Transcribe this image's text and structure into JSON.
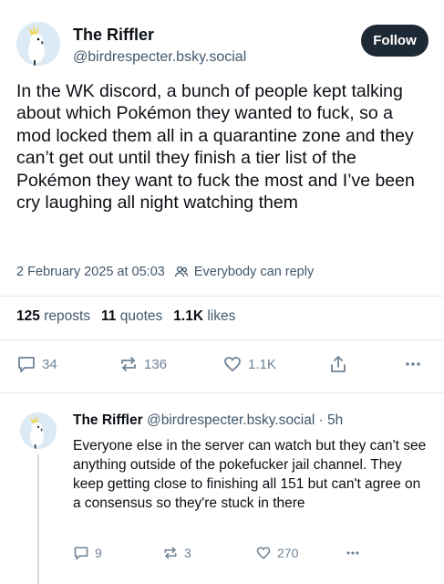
{
  "post": {
    "author_name": "The Riffler",
    "author_handle": "@birdrespecter.bsky.social",
    "follow_label": "Follow",
    "text": "In the WK discord, a bunch of people kept talking about which Pokémon they wanted to fuck, so a mod locked them all in a quarantine zone and they can’t get out until they finish a tier list of the Pokémon they want to fuck the most and I’ve been cry laughing all night watching them",
    "timestamp": "2 February 2025 at 05:03",
    "audience": "Everybody can reply",
    "stats": {
      "reposts_count": "125",
      "reposts_label": "reposts",
      "quotes_count": "11",
      "quotes_label": "quotes",
      "likes_count": "1.1K",
      "likes_label": "likes"
    },
    "actions": {
      "replies": "34",
      "reposts": "136",
      "likes": "1.1K"
    }
  },
  "reply": {
    "author_name": "The Riffler",
    "author_handle": "@birdrespecter.bsky.social",
    "age": "· 5h",
    "text": "Everyone else in the server can watch but they can't see anything outside of the pokefucker jail channel. They keep getting close to finishing all 151 but can't agree on a consensus so they're stuck in there",
    "actions": {
      "replies": "9",
      "reposts": "3",
      "likes": "270"
    }
  },
  "icons": {
    "reply": "speech-bubble-icon",
    "repost": "repost-arrows-icon",
    "like": "heart-icon",
    "share": "share-icon",
    "more": "more-dots-icon",
    "audience": "people-icon"
  },
  "colors": {
    "follow_bg": "#1e2936",
    "muted_text": "#42576c",
    "icon_gray": "#6f8396"
  }
}
